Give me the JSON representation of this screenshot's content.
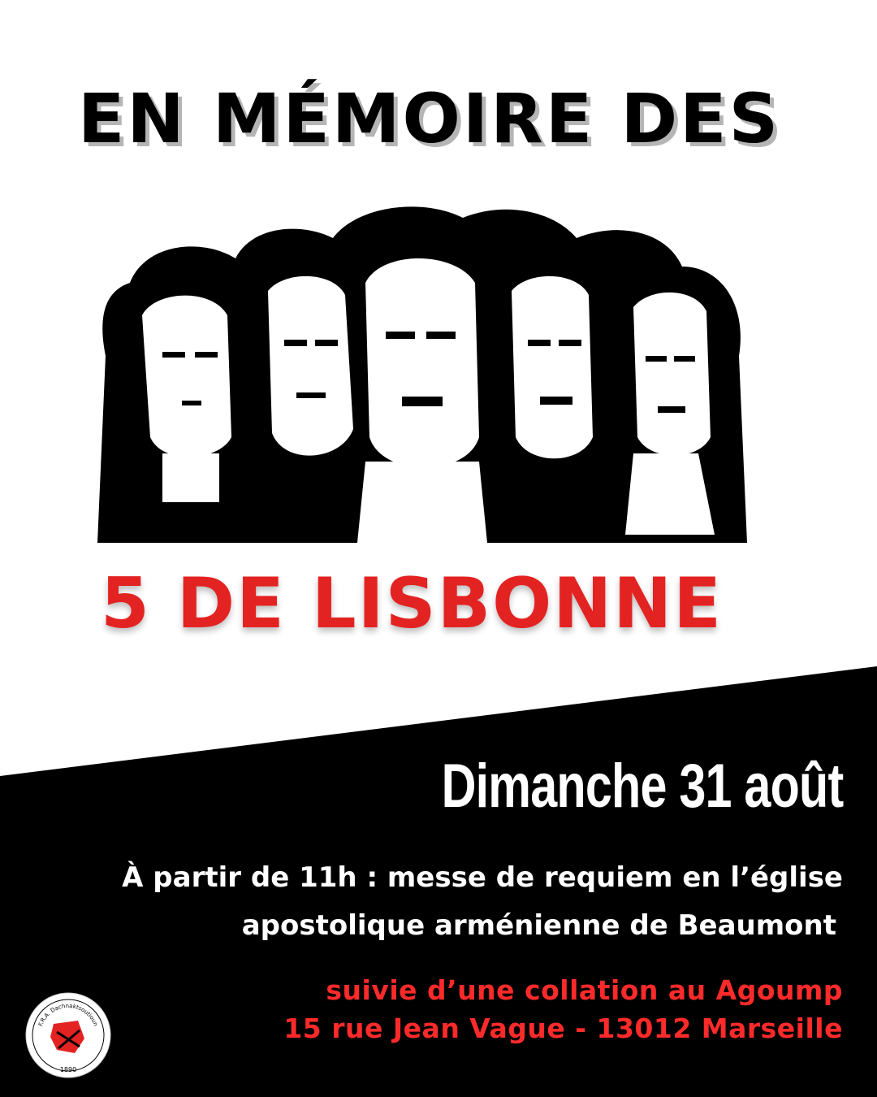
{
  "headline": "EN MÉMOIRE DES",
  "subject": "5 DE LISBONNE",
  "date": "Dimanche 31 août",
  "mass": {
    "line1": "À partir de 11h : messe de requiem en l’église",
    "line2": "apostolique arménienne de Beaumont"
  },
  "collation": {
    "line1": "suivie d’une collation au Agoump",
    "line2": "15 rue Jean Vague - 13012 Marseille"
  },
  "logo": {
    "ring_text": "F.R.A. Dachnaktsoutioun",
    "year": "1890",
    "icon": "fra-emblem-icon"
  },
  "colors": {
    "black": "#000000",
    "white": "#ffffff",
    "red": "#e32322",
    "address_red": "#ff2a2a",
    "shadow_gray": "#b5b5b5"
  }
}
